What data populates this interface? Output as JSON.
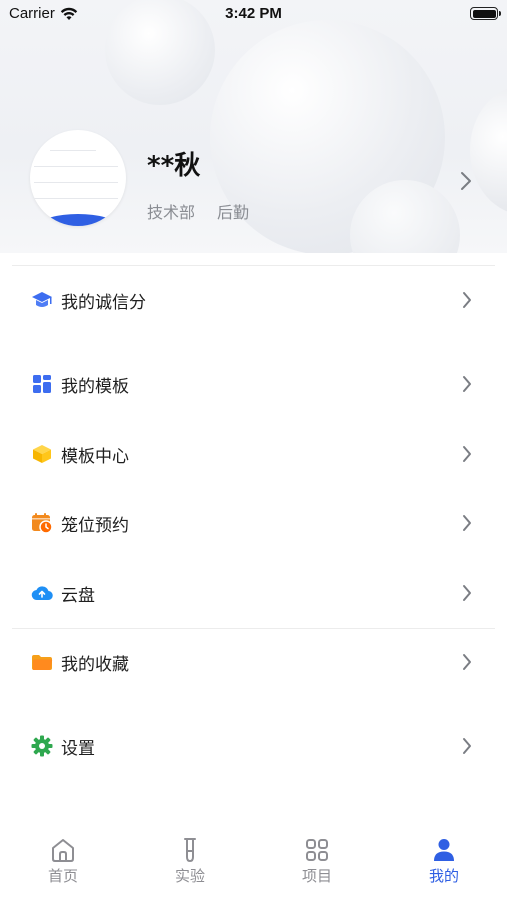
{
  "status_bar": {
    "carrier": "Carrier",
    "time": "3:42 PM"
  },
  "profile": {
    "name": "**秋",
    "department": "技术部",
    "role": "后勤"
  },
  "menu": {
    "credit_score": "我的诚信分",
    "my_templates": "我的模板",
    "template_center": "模板中心",
    "cage_booking": "笼位预约",
    "cloud_disk": "云盘",
    "my_favorites": "我的收藏",
    "settings": "设置"
  },
  "tabbar": {
    "home": "首页",
    "experiment": "实验",
    "project": "项目",
    "mine": "我的",
    "active_color": "#2f5fe3",
    "inactive_color": "#8e8e93"
  },
  "icons": {
    "credit_score": "graduation-cap-icon",
    "my_templates": "template-grid-icon",
    "template_center": "cube-icon",
    "cage_booking": "calendar-clock-icon",
    "cloud_disk": "cloud-upload-icon",
    "my_favorites": "folder-icon",
    "settings": "gear-icon"
  }
}
